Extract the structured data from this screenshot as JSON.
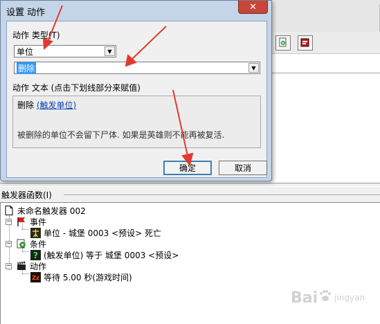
{
  "dialog": {
    "title": "设置 动作",
    "close_glyph": "✕",
    "action_type_label": "动作 类型(T)",
    "category_select": {
      "value": "单位"
    },
    "action_select": {
      "value": "删除"
    },
    "action_text_label": "动作 文本 (点击下划线部分来赋值)",
    "action_text": {
      "prefix": "删除 ",
      "link": "(触发单位)"
    },
    "description": "被删除的单位不会留下尸体. 如果是英雄则不能再被复活.",
    "ok_button": "确定",
    "cancel_button": "取消"
  },
  "toolbar": {
    "buttons": [
      {
        "icon": "new-condition-icon"
      },
      {
        "icon": "new-action-icon"
      }
    ]
  },
  "trigger_panel": {
    "header": "触发器函数(I)",
    "root": {
      "label": "未命名触发器 002",
      "icon": "document-icon"
    },
    "events": {
      "label": "事件",
      "icon": "red-flag-icon",
      "items": [
        {
          "label": "单位 - 城堡 0003 <预设> 死亡",
          "icon": "unit-event-icon"
        }
      ]
    },
    "conditions": {
      "label": "条件",
      "icon": "condition-icon",
      "items": [
        {
          "label": "(触发单位) 等于 城堡 0003 <预设>",
          "icon": "question-icon"
        }
      ]
    },
    "actions": {
      "label": "动作",
      "icon": "clapper-icon",
      "items": [
        {
          "label": "等待 5.00 秒(游戏时间)",
          "icon": "wait-icon"
        }
      ]
    }
  },
  "watermark": {
    "text": "Bai",
    "suffix": "jingyan"
  },
  "colors": {
    "selection": "#3399ff",
    "link": "#0645ad",
    "annotation_arrow": "#e03a2f",
    "close_button": "#c8453a"
  }
}
